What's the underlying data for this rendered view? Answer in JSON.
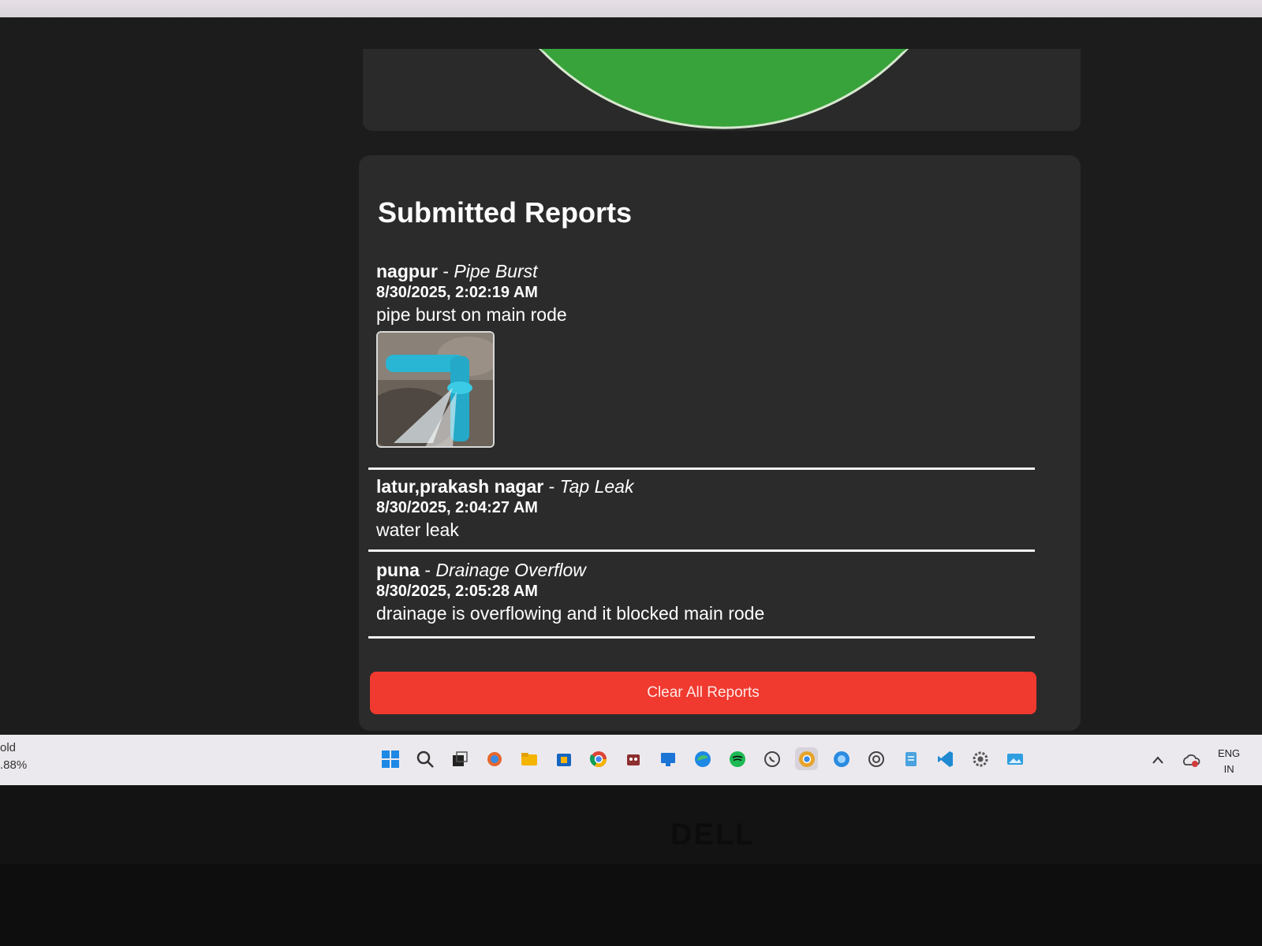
{
  "chart": {
    "slice_color": "#37a33a"
  },
  "reports": {
    "title": "Submitted Reports",
    "items": [
      {
        "location": "nagpur",
        "separator": " - ",
        "type": "Pipe Burst",
        "timestamp": "8/30/2025, 2:02:19 AM",
        "description": "pipe burst on main rode",
        "has_photo": true
      },
      {
        "location": "latur,prakash nagar",
        "separator": " - ",
        "type": "Tap Leak",
        "timestamp": "8/30/2025, 2:04:27 AM",
        "description": "water leak"
      },
      {
        "location": "puna",
        "separator": " - ",
        "type": "Drainage Overflow",
        "timestamp": "8/30/2025, 2:05:28 AM",
        "description": "drainage is overflowing and it blocked main rode"
      }
    ],
    "clear_button_label": "Clear All Reports",
    "clear_button_color": "#f0392f"
  },
  "taskbar": {
    "left_line1": "old",
    "left_line2": ".88%",
    "language": "ENG",
    "region": "IN",
    "icons": [
      "windows-start-icon",
      "search-icon",
      "task-view-icon",
      "copilot-icon",
      "file-explorer-icon",
      "store-icon",
      "chrome-icon",
      "app-icon",
      "teams-icon",
      "edge-icon",
      "spotify-icon",
      "whatsapp-icon",
      "chrome-canary-icon",
      "edge-dev-icon",
      "chatgpt-icon",
      "notepad-icon",
      "vscode-icon",
      "settings-icon",
      "photos-icon"
    ]
  },
  "bezel": {
    "brand": "DELL"
  }
}
